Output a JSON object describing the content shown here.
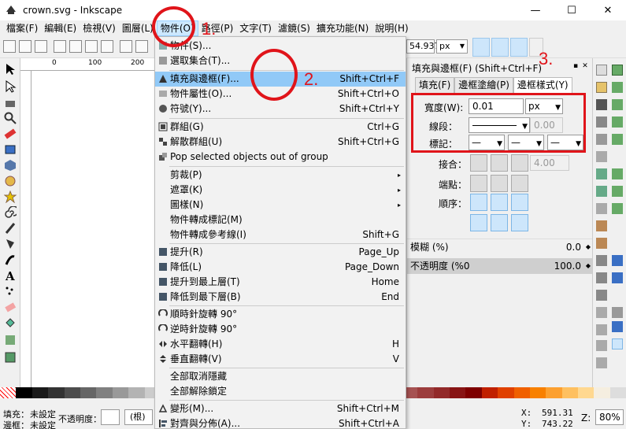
{
  "window": {
    "title": "crown.svg - Inkscape",
    "controls": [
      "—",
      "☐",
      "✕"
    ]
  },
  "menubar": [
    "檔案(F)",
    "編輯(E)",
    "檢視(V)",
    "圖層(L)",
    "物件(O)",
    "路徑(P)",
    "文字(T)",
    "濾鏡(S)",
    "擴充功能(N)",
    "說明(H)"
  ],
  "toolbar": {
    "value": "54.937",
    "unit": "px"
  },
  "ruler": {
    "labels": [
      "0",
      "100",
      "200"
    ]
  },
  "object_menu": {
    "items": [
      {
        "label": "物件(S)...",
        "shortcut": ""
      },
      {
        "label": "選取集合(T)...",
        "shortcut": ""
      },
      {
        "label": "填充與邊框(F)...",
        "shortcut": "Shift+Ctrl+F"
      },
      {
        "label": "物件屬性(O)...",
        "shortcut": "Shift+Ctrl+O"
      },
      {
        "label": "符號(Y)...",
        "shortcut": "Shift+Ctrl+Y"
      },
      {
        "label": "群組(G)",
        "shortcut": "Ctrl+G"
      },
      {
        "label": "解散群組(U)",
        "shortcut": "Shift+Ctrl+G"
      },
      {
        "label": "Pop selected objects out of group",
        "shortcut": ""
      },
      {
        "label": "剪裁(P)",
        "shortcut": ""
      },
      {
        "label": "遮罩(K)",
        "shortcut": ""
      },
      {
        "label": "圖樣(N)",
        "shortcut": ""
      },
      {
        "label": "物件轉成標記(M)",
        "shortcut": ""
      },
      {
        "label": "物件轉成參考線(I)",
        "shortcut": "Shift+G"
      },
      {
        "label": "提升(R)",
        "shortcut": "Page_Up"
      },
      {
        "label": "降低(L)",
        "shortcut": "Page_Down"
      },
      {
        "label": "提升到最上層(T)",
        "shortcut": "Home"
      },
      {
        "label": "降低到最下層(B)",
        "shortcut": "End"
      },
      {
        "label": "順時針旋轉 90°",
        "shortcut": ""
      },
      {
        "label": "逆時針旋轉 90°",
        "shortcut": ""
      },
      {
        "label": "水平翻轉(H)",
        "shortcut": "H"
      },
      {
        "label": "垂直翻轉(V)",
        "shortcut": "V"
      },
      {
        "label": "全部取消隱藏",
        "shortcut": ""
      },
      {
        "label": "全部解除鎖定",
        "shortcut": ""
      },
      {
        "label": "變形(M)...",
        "shortcut": "Shift+Ctrl+M"
      },
      {
        "label": "對齊與分佈(A)...",
        "shortcut": "Shift+Ctrl+A"
      }
    ]
  },
  "panel": {
    "title": "填充與邊框(F) (Shift+Ctrl+F)",
    "tabs": [
      "填充(F)",
      "邊框塗繪(P)",
      "邊框樣式(Y)"
    ],
    "width_label": "寬度(W):",
    "width_value": "0.01",
    "width_unit": "px",
    "dash_label": "線段：",
    "dash_value": "0.00",
    "marker_label": "標記：",
    "join_label": "接合：",
    "join_value": "4.00",
    "cap_label": "端點：",
    "order_label": "順序：",
    "blur_label": "模糊 (%)",
    "blur_value": "0.0",
    "opacity_label": "不透明度 (%0",
    "opacity_value": "100.0"
  },
  "status": {
    "fill_label": "填充：",
    "fill_value": "未設定",
    "stroke_label": "邊框：",
    "stroke_value": "未設定",
    "opacity_label": "不透明度：",
    "root_label": "(根)",
    "x_label": "X:",
    "x_value": "591.31",
    "y_label": "Y:",
    "y_value": "743.22",
    "zoom_label": "Z:",
    "zoom_value": "80%"
  },
  "annotations": [
    "1.",
    "2.",
    "3."
  ],
  "colors": {
    "annotation": "#e0141a",
    "highlight": "#91c9f7",
    "menu_active": "#cce8ff"
  }
}
